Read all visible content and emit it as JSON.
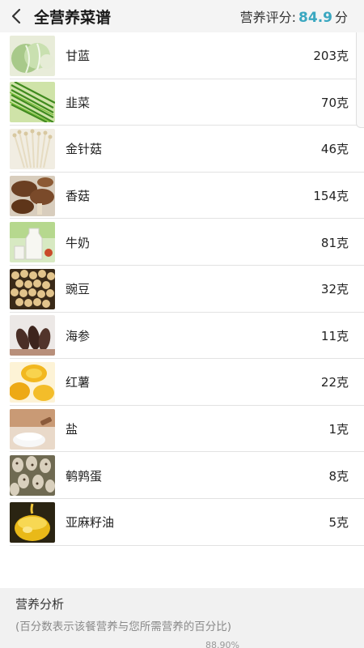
{
  "header": {
    "title": "全营养菜谱",
    "score_label": "营养评分:",
    "score_value": "84.9",
    "score_unit": "分"
  },
  "items": [
    {
      "name": "甘蓝",
      "amount": "203克",
      "icon": "cabbage-icon"
    },
    {
      "name": "韭菜",
      "amount": "70克",
      "icon": "chives-icon"
    },
    {
      "name": "金针菇",
      "amount": "46克",
      "icon": "enoki-mushroom-icon"
    },
    {
      "name": "香菇",
      "amount": "154克",
      "icon": "shiitake-mushroom-icon"
    },
    {
      "name": "牛奶",
      "amount": "81克",
      "icon": "milk-icon"
    },
    {
      "name": "豌豆",
      "amount": "32克",
      "icon": "pea-icon"
    },
    {
      "name": "海参",
      "amount": "11克",
      "icon": "sea-cucumber-icon"
    },
    {
      "name": "红薯",
      "amount": "22克",
      "icon": "sweet-potato-icon"
    },
    {
      "name": "盐",
      "amount": "1克",
      "icon": "salt-icon"
    },
    {
      "name": "鹌鹑蛋",
      "amount": "8克",
      "icon": "quail-egg-icon"
    },
    {
      "name": "亚麻籽油",
      "amount": "5克",
      "icon": "flaxseed-oil-icon"
    }
  ],
  "analysis": {
    "title": "营养分析",
    "note": "(百分数表示该餐营养与您所需营养的百分比)",
    "first_percent": "88.90%"
  },
  "colors": {
    "accent": "#3aa7c0",
    "header_bg": "#f4f4f4",
    "analysis_bg": "#f1f1f1"
  }
}
